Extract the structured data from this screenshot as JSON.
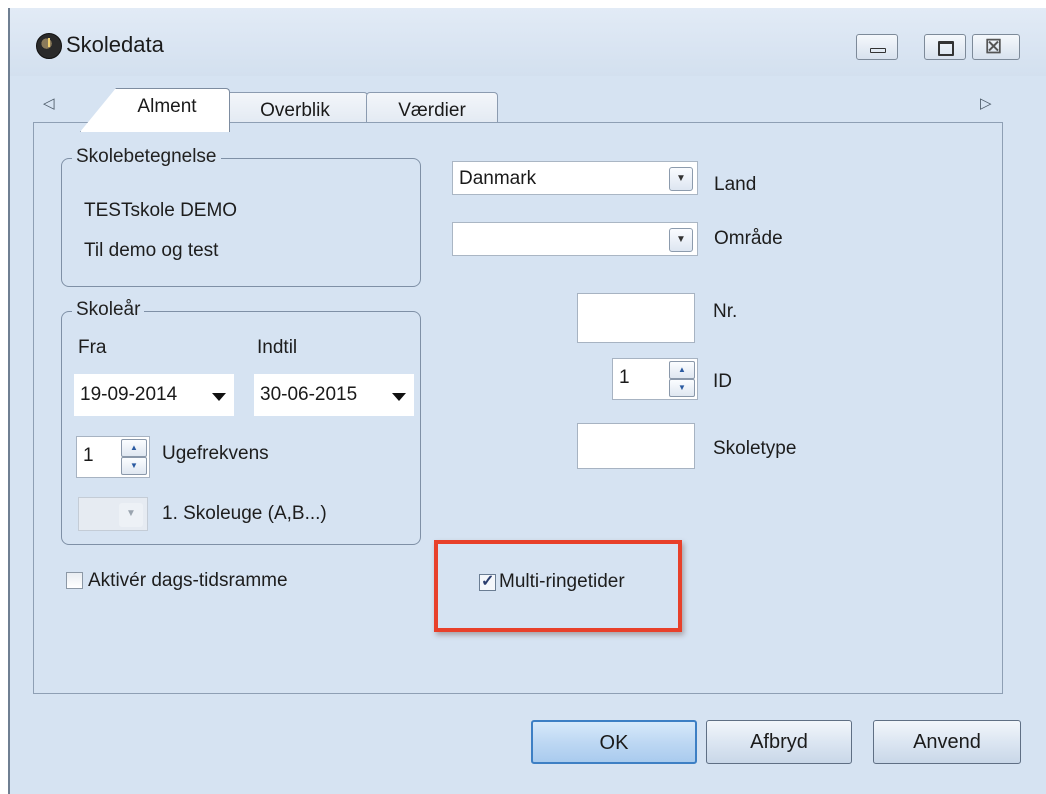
{
  "window": {
    "title": "Skoledata",
    "icon": "school-data-app-icon",
    "controls": {
      "minimize": "minimize-icon",
      "maximize": "maximize-icon",
      "close": "close-icon",
      "close_glyph": "☒"
    }
  },
  "tabs": {
    "left_arrow": "◁",
    "right_arrow": "▷",
    "items": [
      {
        "label": "Alment",
        "active": true
      },
      {
        "label": "Overblik",
        "active": false
      },
      {
        "label": "Værdier",
        "active": false
      }
    ]
  },
  "skolebetegnelse": {
    "legend": "Skolebetegnelse",
    "name": "TESTskole  DEMO",
    "description": "Til demo og test"
  },
  "skoleaar": {
    "legend": "Skoleår",
    "from_label": "Fra",
    "to_label": "Indtil",
    "from_value": "19-09-2014",
    "to_value": "30-06-2015",
    "week_freq_value": "1",
    "week_freq_label": "Ugefrekvens",
    "first_week_label": "1. Skoleuge (A,B...)"
  },
  "aktiver": {
    "label": "Aktivér dags-tidsramme",
    "checked": false
  },
  "land": {
    "value": "Danmark",
    "label": "Land"
  },
  "omraade": {
    "value": "",
    "label": "Område"
  },
  "nr": {
    "value": "",
    "label": "Nr."
  },
  "id": {
    "value": "1",
    "label": "ID"
  },
  "skoletype": {
    "value": "",
    "label": "Skoletype"
  },
  "multi": {
    "label": "Multi-ringetider",
    "checked": true,
    "highlight_color": "#e8402a"
  },
  "buttons": {
    "ok": "OK",
    "cancel": "Afbryd",
    "apply": "Anvend"
  },
  "colors": {
    "background": "#d6e3f2",
    "ok_border": "#3d7fc4"
  }
}
